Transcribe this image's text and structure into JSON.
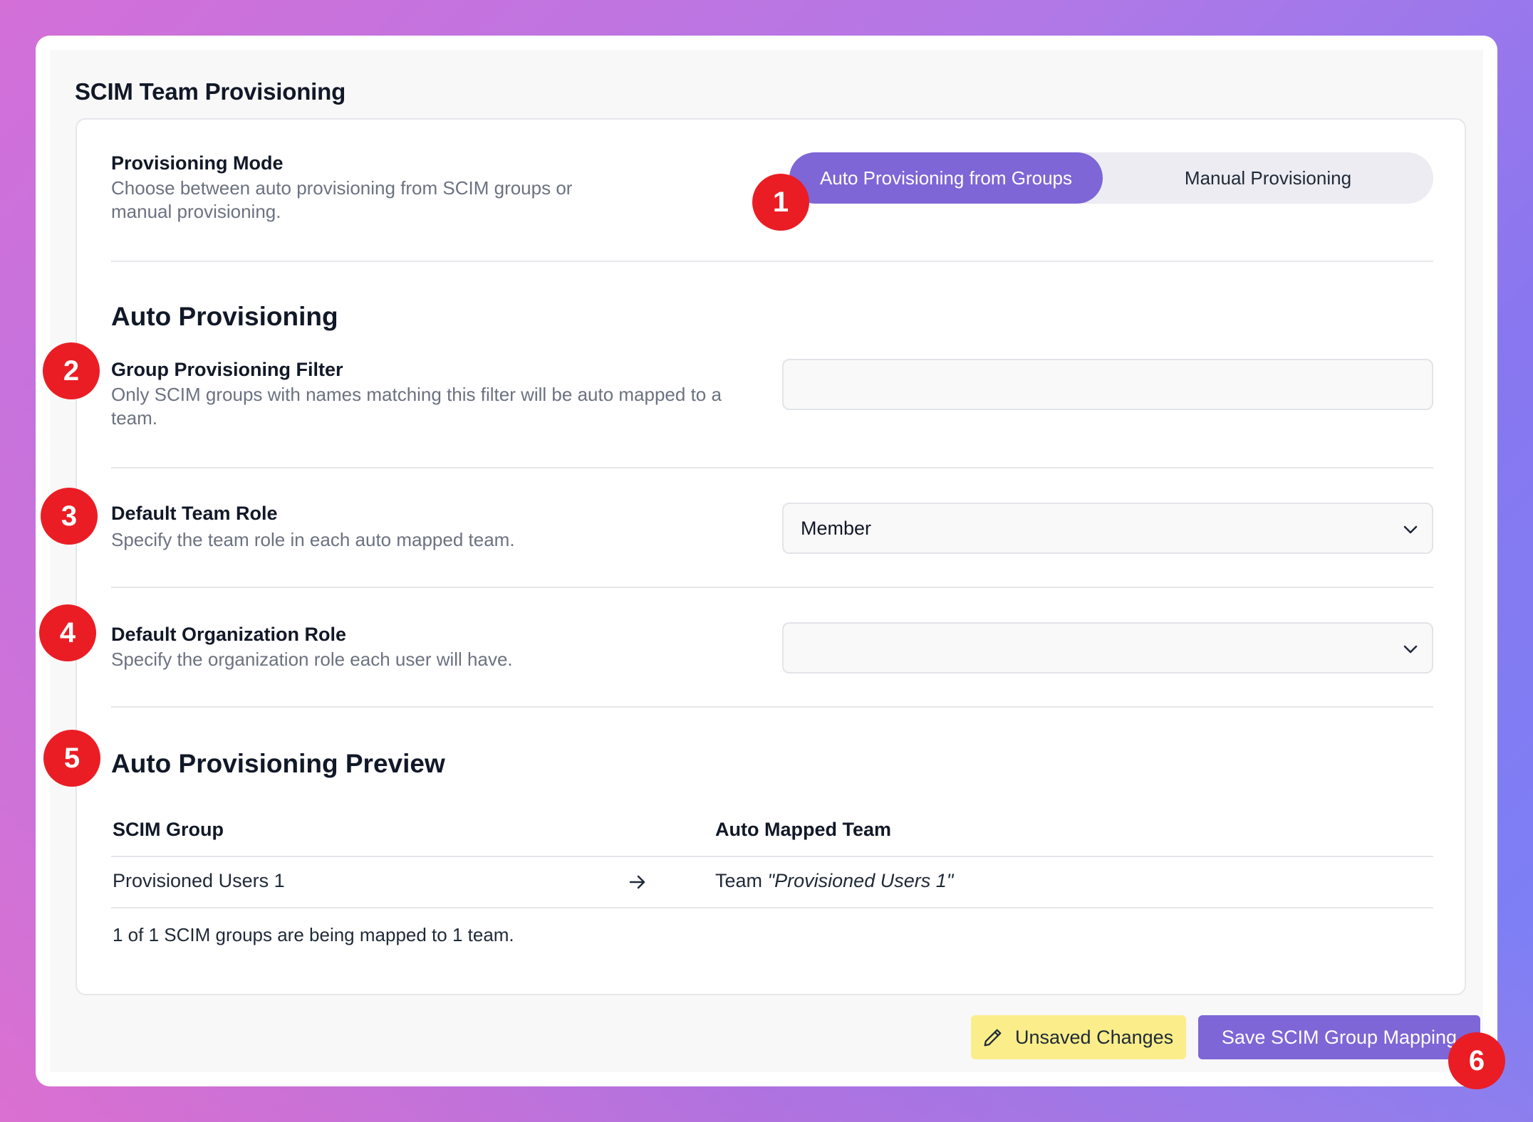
{
  "page": {
    "title": "SCIM Team Provisioning"
  },
  "provisioning_mode": {
    "label": "Provisioning Mode",
    "description": "Choose between auto provisioning from SCIM groups or manual provisioning.",
    "options": [
      "Auto Provisioning from Groups",
      "Manual Provisioning"
    ],
    "selected": "Auto Provisioning from Groups"
  },
  "auto_provisioning": {
    "title": "Auto Provisioning",
    "group_filter": {
      "label": "Group Provisioning Filter",
      "description": "Only SCIM groups with names matching this filter will be auto mapped to a team.",
      "value": "",
      "placeholder": ""
    },
    "default_team_role": {
      "label": "Default Team Role",
      "description": "Specify the team role in each auto mapped team.",
      "value": "Member"
    },
    "default_org_role": {
      "label": "Default Organization Role",
      "description": "Specify the organization role each user will have.",
      "value": ""
    }
  },
  "preview": {
    "title": "Auto Provisioning Preview",
    "columns": [
      "SCIM Group",
      "Auto Mapped Team"
    ],
    "rows": [
      {
        "scim_group": "Provisioned Users 1",
        "team_prefix": "Team",
        "team_name": "\"Provisioned Users 1\""
      }
    ],
    "summary": "1 of 1 SCIM groups are being mapped to 1 team."
  },
  "footer": {
    "unsaved_label": "Unsaved Changes",
    "save_label": "Save SCIM Group Mapping"
  },
  "badges": [
    "1",
    "2",
    "3",
    "4",
    "5",
    "6"
  ],
  "colors": {
    "accent": "#7e66d6",
    "warning_bg": "#fbee8a",
    "badge": "#ea1d24"
  },
  "icons": [
    "pencil-icon",
    "arrow-right-icon",
    "chevron-down-icon"
  ]
}
